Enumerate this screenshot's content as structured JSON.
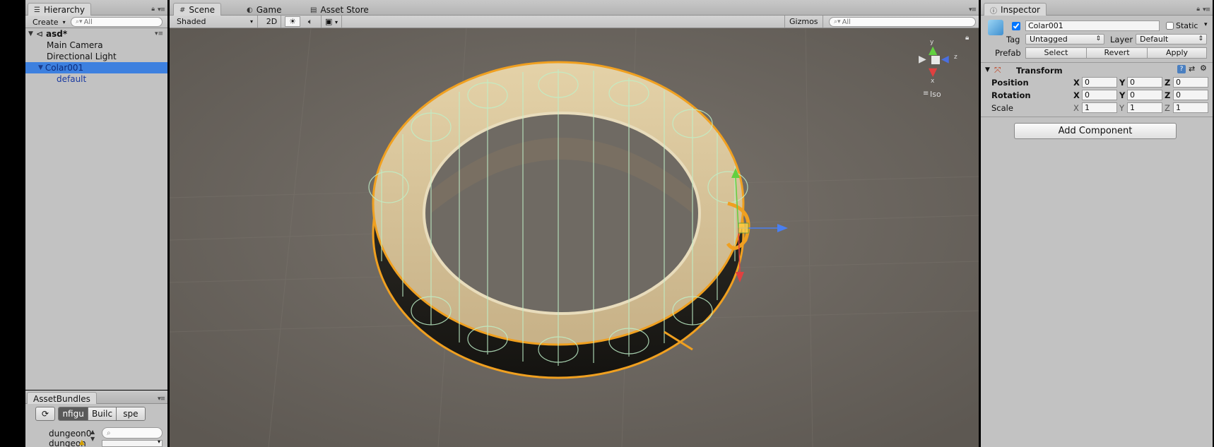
{
  "hierarchy": {
    "tab_label": "Hierarchy",
    "create_label": "Create",
    "search_placeholder": "All",
    "scene_name": "asd*",
    "items": [
      {
        "label": "Main Camera"
      },
      {
        "label": "Directional Light"
      },
      {
        "label": "Colar001"
      },
      {
        "label": "default"
      }
    ]
  },
  "assetbundles": {
    "tab_label": "AssetBundles",
    "tabs": [
      "nfigu",
      "Builc",
      "spe"
    ],
    "items": [
      "dungeon0",
      "dungeon"
    ]
  },
  "scene_view": {
    "tabs": [
      "Scene",
      "Game",
      "Asset Store"
    ],
    "shading_mode": "Shaded",
    "mode_2d": "2D",
    "gizmos_label": "Gizmos",
    "search_placeholder": "All",
    "projection_label": "Iso",
    "axis_labels": {
      "y": "y",
      "z": "z",
      "x": "x"
    }
  },
  "inspector": {
    "tab_label": "Inspector",
    "object_name": "Colar001",
    "active": true,
    "static_label": "Static",
    "static_checked": false,
    "tag_label": "Tag",
    "tag_value": "Untagged",
    "layer_label": "Layer",
    "layer_value": "Default",
    "prefab_label": "Prefab",
    "prefab_buttons": [
      "Select",
      "Revert",
      "Apply"
    ],
    "transform": {
      "title": "Transform",
      "rows": [
        {
          "label": "Position",
          "x": "0",
          "y": "0",
          "z": "0"
        },
        {
          "label": "Rotation",
          "x": "0",
          "y": "0",
          "z": "0"
        },
        {
          "label": "Scale",
          "x": "1",
          "y": "1",
          "z": "1"
        }
      ],
      "axis_x": "X",
      "axis_y": "Y",
      "axis_z": "Z"
    },
    "add_component_label": "Add Component"
  }
}
